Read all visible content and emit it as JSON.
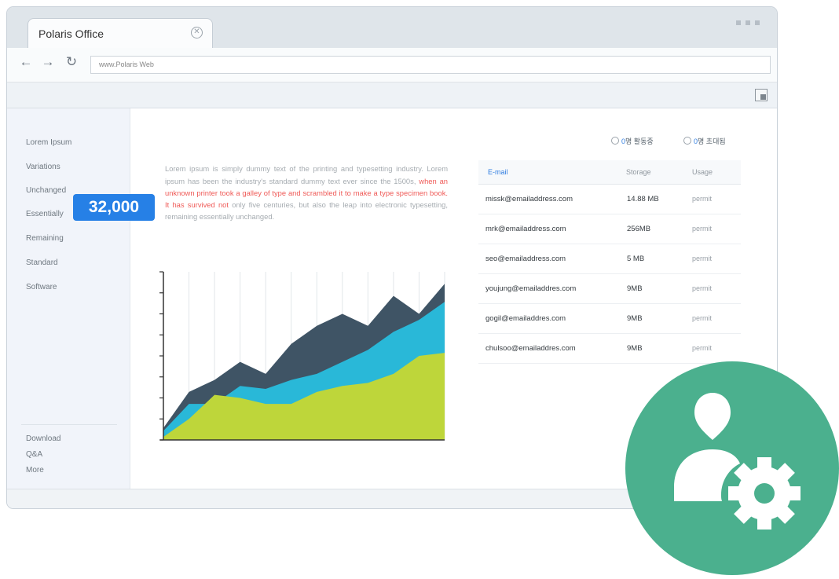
{
  "browser": {
    "tab_title": "Polaris Office",
    "url": "www.Polaris Web"
  },
  "sidebar": {
    "items": [
      "Lorem Ipsum",
      "Variations",
      "Unchanged",
      "Essentially",
      "Remaining",
      "Standard",
      "Software"
    ],
    "footer_items": [
      "Download",
      "Q&A",
      "More"
    ]
  },
  "content": {
    "text_before": "Lorem ipsum is simply dummy text of the printing and typesetting industry. Lorem ipsum has been the industry's standard dummy text ever since the 1500s, ",
    "text_highlight": "when an unknown printer took a galley of type and scrambled it to make a type specimen book. It has survived not",
    "text_after": " only five centuries, but also the leap into electronic typesetting, remaining essentially unchanged."
  },
  "chart_data": {
    "type": "area",
    "x": [
      1,
      2,
      3,
      4,
      5,
      6,
      7,
      8,
      9,
      10,
      11,
      12
    ],
    "series": [
      {
        "values": [
          2,
          8,
          10,
          13,
          11,
          16,
          19,
          21,
          19,
          24,
          21,
          26
        ],
        "color": "#3f5465"
      },
      {
        "values": [
          1.5,
          6,
          6,
          9,
          8.5,
          10,
          11,
          13,
          15,
          18,
          20,
          23
        ],
        "color": "#29b8d8"
      },
      {
        "values": [
          0.5,
          3.5,
          7.5,
          7,
          6,
          6,
          8,
          9,
          9.5,
          11,
          14,
          14.5
        ],
        "color": "#bed63a"
      }
    ],
    "ylim": [
      0,
      28
    ],
    "grid": true,
    "annotation": "32,000"
  },
  "status": {
    "active_count": "0",
    "active_label": "명 활동중",
    "invited_count": "0",
    "invited_label": "명 초대됨"
  },
  "table": {
    "headers": [
      "E-mail",
      "Storage",
      "Usage"
    ],
    "rows": [
      [
        "missk@emailaddress.com",
        "14.88 MB",
        "permit"
      ],
      [
        "mrk@emailaddress.com",
        "256MB",
        "permit"
      ],
      [
        "seo@emailaddress.com",
        "5 MB",
        "permit"
      ],
      [
        "youjung@emailaddres.com",
        "9MB",
        "permit"
      ],
      [
        "gogil@emailaddres.com",
        "9MB",
        "permit"
      ],
      [
        "chulsoo@emailaddres.com",
        "9MB",
        "permit"
      ]
    ]
  },
  "colors": {
    "accent": "#2680e6",
    "badge": "#4bb08e",
    "highlight_text": "#ef5a57"
  },
  "icons": {
    "admin_badge": "user-settings-icon"
  }
}
